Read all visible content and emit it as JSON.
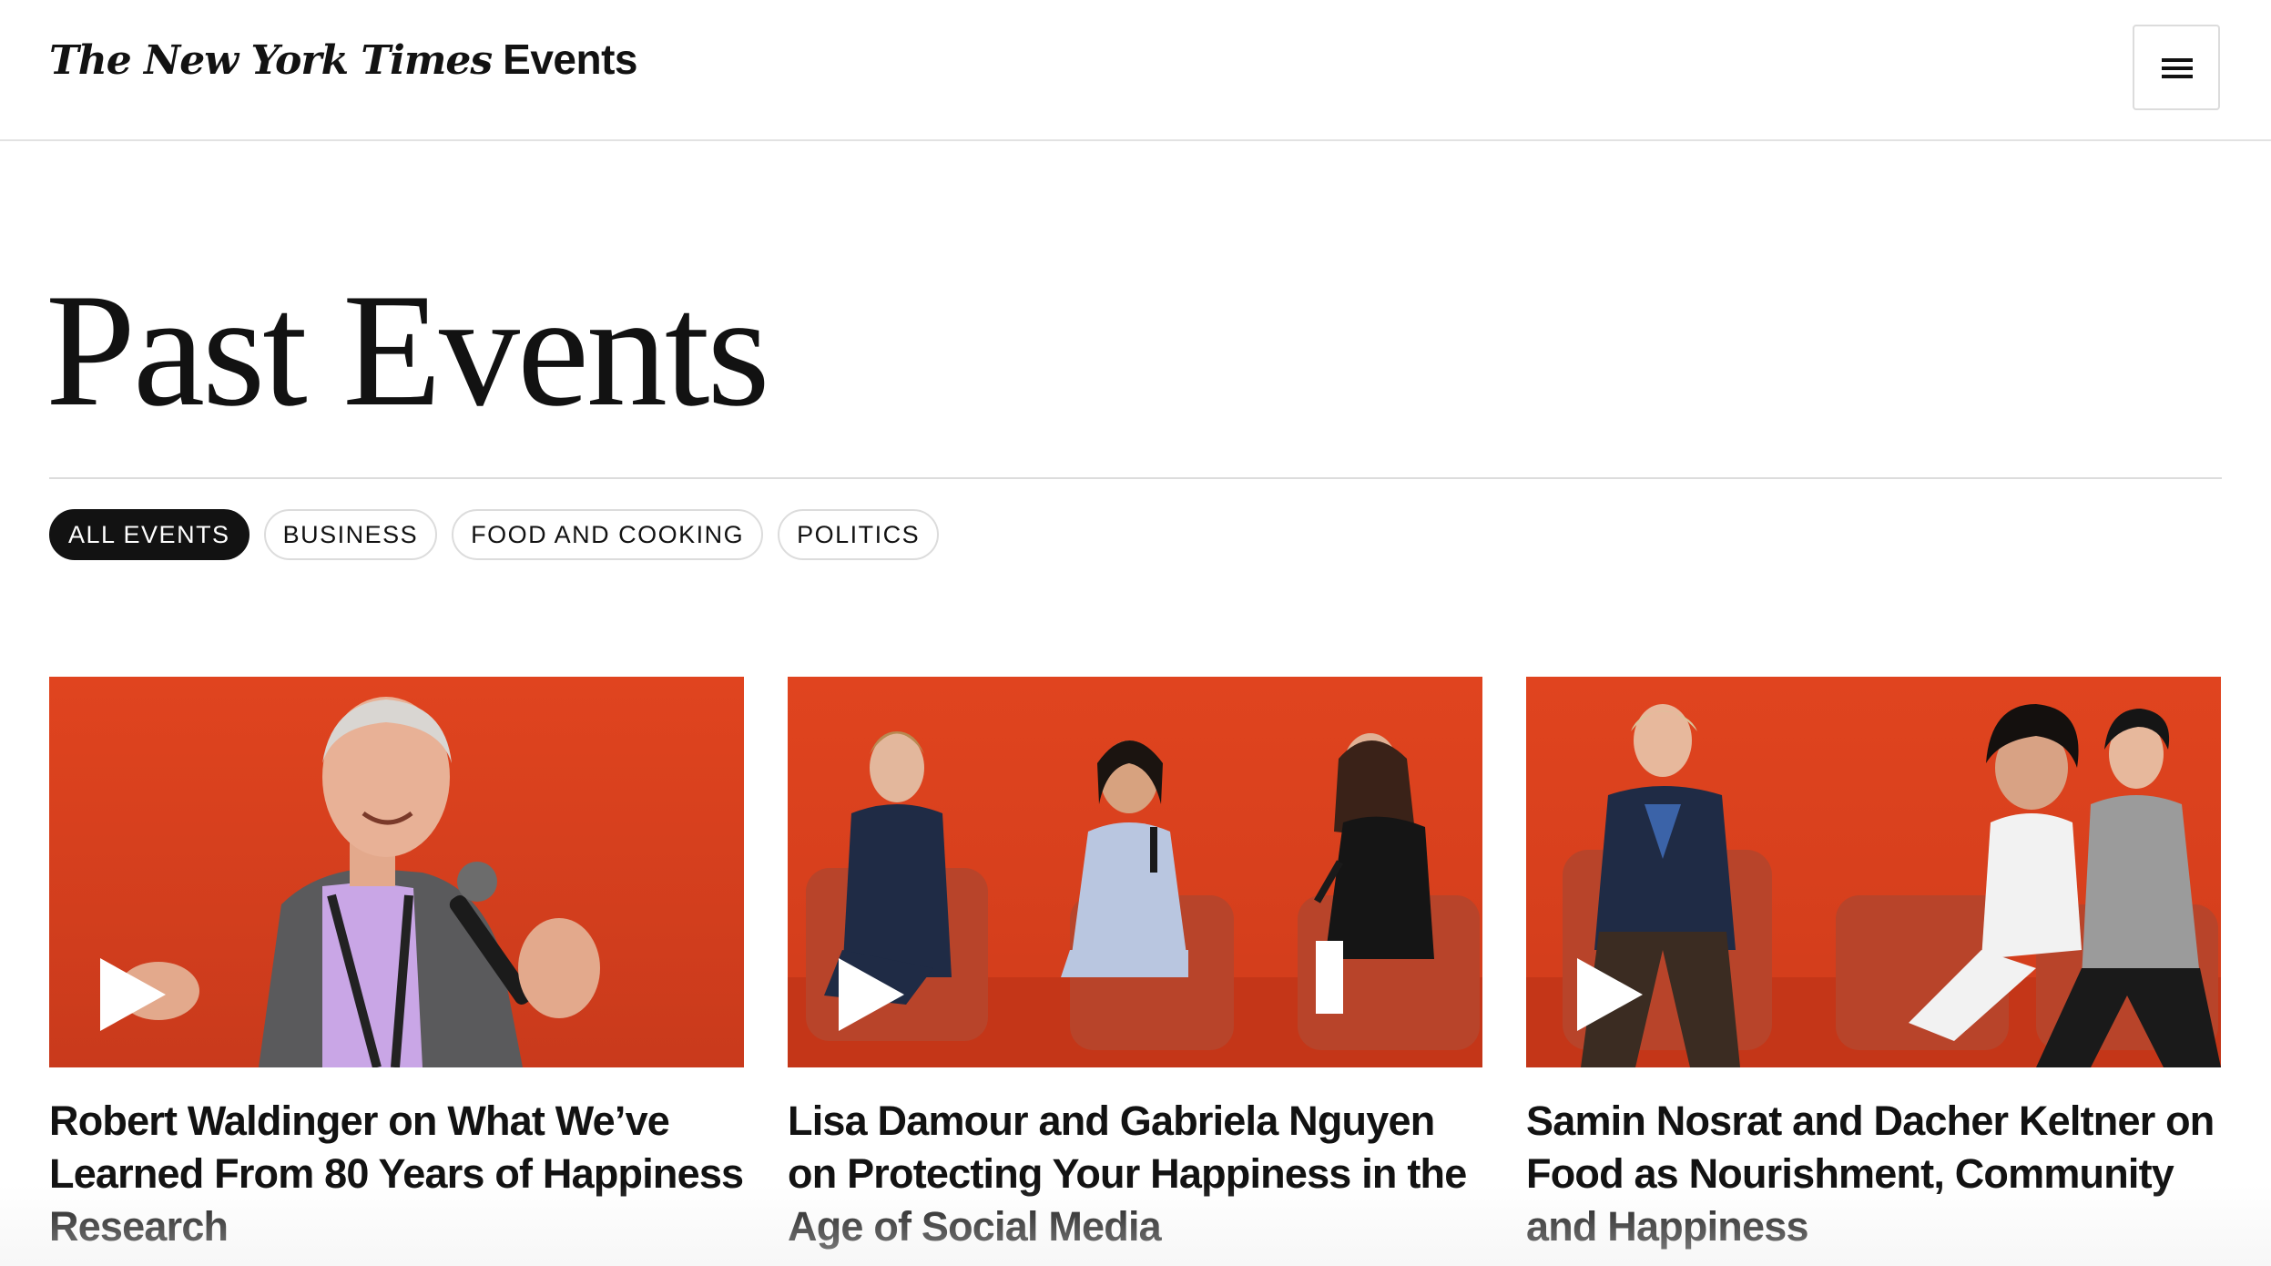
{
  "header": {
    "logo_nyt": "The New York Times",
    "logo_events": "Events",
    "menu_icon": "hamburger-menu-icon"
  },
  "page": {
    "title": "Past Events"
  },
  "filters": [
    {
      "label": "ALL EVENTS",
      "active": true
    },
    {
      "label": "BUSINESS",
      "active": false
    },
    {
      "label": "FOOD AND COOKING",
      "active": false
    },
    {
      "label": "POLITICS",
      "active": false
    }
  ],
  "events": [
    {
      "title": "Robert Waldinger on What We’ve Learned From 80 Years of Happiness Research",
      "media_icon": "play-icon"
    },
    {
      "title": "Lisa Damour and Gabriela Nguyen on Protecting Your Happiness in the Age of Social Media",
      "media_icon": "play-icon"
    },
    {
      "title": "Samin Nosrat and Dacher Keltner on Food as Nourishment, Community and Happiness",
      "media_icon": "play-icon"
    }
  ],
  "colors": {
    "background": "#ffffff",
    "text": "#121212",
    "accent_stage": "#d9401f",
    "divider": "#dcdcdc"
  }
}
